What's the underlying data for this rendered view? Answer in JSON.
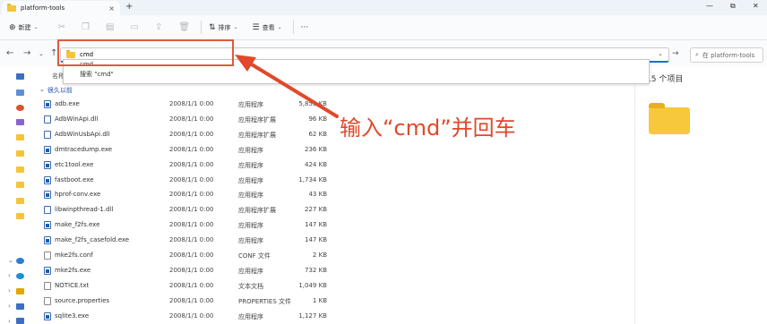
{
  "window": {
    "tab_title": "platform-tools",
    "tab_close": "×",
    "new_tab": "+",
    "controls": [
      "—",
      "⧉",
      "✕"
    ]
  },
  "toolbar": {
    "new_label": "新建",
    "sort_label": "排序",
    "view_label": "查看",
    "more_label": "···"
  },
  "address": {
    "value": "cmd",
    "search_placeholder": "在 platform-tools"
  },
  "suggestions": {
    "item1": "cmd",
    "item2": "搜索 \"cmd\""
  },
  "list": {
    "name_header": "名称",
    "group_label": "很久以前",
    "rows": [
      {
        "name": "adb.exe",
        "date": "2008/1/1 0:00",
        "type": "应用程序",
        "size": "5,853 KB",
        "icon": "exe"
      },
      {
        "name": "AdbWinApi.dll",
        "date": "2008/1/1 0:00",
        "type": "应用程序扩展",
        "size": "96 KB",
        "icon": "dll"
      },
      {
        "name": "AdbWinUsbApi.dll",
        "date": "2008/1/1 0:00",
        "type": "应用程序扩展",
        "size": "62 KB",
        "icon": "dll"
      },
      {
        "name": "dmtracedump.exe",
        "date": "2008/1/1 0:00",
        "type": "应用程序",
        "size": "236 KB",
        "icon": "exe"
      },
      {
        "name": "etc1tool.exe",
        "date": "2008/1/1 0:00",
        "type": "应用程序",
        "size": "424 KB",
        "icon": "exe"
      },
      {
        "name": "fastboot.exe",
        "date": "2008/1/1 0:00",
        "type": "应用程序",
        "size": "1,734 KB",
        "icon": "exe"
      },
      {
        "name": "hprof-conv.exe",
        "date": "2008/1/1 0:00",
        "type": "应用程序",
        "size": "43 KB",
        "icon": "exe"
      },
      {
        "name": "libwinpthread-1.dll",
        "date": "2008/1/1 0:00",
        "type": "应用程序扩展",
        "size": "227 KB",
        "icon": "dll"
      },
      {
        "name": "make_f2fs.exe",
        "date": "2008/1/1 0:00",
        "type": "应用程序",
        "size": "147 KB",
        "icon": "exe"
      },
      {
        "name": "make_f2fs_casefold.exe",
        "date": "2008/1/1 0:00",
        "type": "应用程序",
        "size": "147 KB",
        "icon": "exe"
      },
      {
        "name": "mke2fs.conf",
        "date": "2008/1/1 0:00",
        "type": "CONF 文件",
        "size": "2 KB",
        "icon": "doc"
      },
      {
        "name": "mke2fs.exe",
        "date": "2008/1/1 0:00",
        "type": "应用程序",
        "size": "732 KB",
        "icon": "exe"
      },
      {
        "name": "NOTICE.txt",
        "date": "2008/1/1 0:00",
        "type": "文本文档",
        "size": "1,049 KB",
        "icon": "doc"
      },
      {
        "name": "source.properties",
        "date": "2008/1/1 0:00",
        "type": "PROPERTIES 文件",
        "size": "1 KB",
        "icon": "doc"
      },
      {
        "name": "sqlite3.exe",
        "date": "2008/1/1 0:00",
        "type": "应用程序",
        "size": "1,127 KB",
        "icon": "exe"
      }
    ]
  },
  "preview": {
    "count": "15 个项目"
  },
  "annotation": {
    "text": "输入“cmd”并回车",
    "color": "#e0492b"
  }
}
